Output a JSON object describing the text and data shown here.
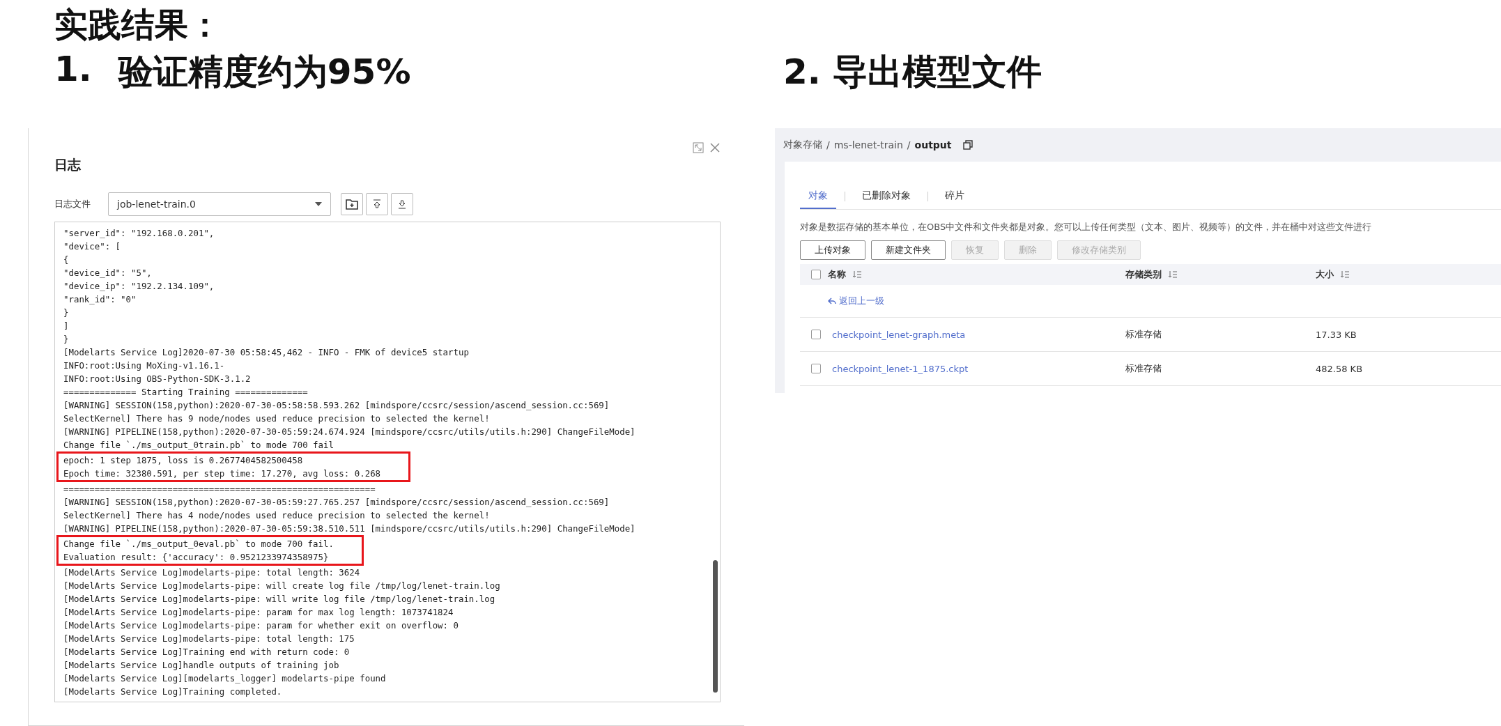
{
  "slide_title": "实践结果：",
  "left": {
    "heading_number": "1.",
    "heading": "验证精度约为95%",
    "log_dialog": {
      "title": "日志",
      "file_label": "日志文件",
      "file_value": "job-lenet-train.0",
      "blocks": [
        {
          "highlighted": false,
          "lines": [
            "\"server_id\": \"192.168.0.201\",",
            "\"device\": [",
            "{",
            "\"device_id\": \"5\",",
            "\"device_ip\": \"192.2.134.109\",",
            "\"rank_id\": \"0\"",
            "}",
            "]",
            "}",
            "[Modelarts Service Log]2020-07-30 05:58:45,462 - INFO - FMK of device5 startup",
            "INFO:root:Using MoXing-v1.16.1-",
            "INFO:root:Using OBS-Python-SDK-3.1.2",
            "============== Starting Training ==============",
            "[WARNING] SESSION(158,python):2020-07-30-05:58:58.593.262 [mindspore/ccsrc/session/ascend_session.cc:569]",
            "SelectKernel] There has 9 node/nodes used reduce precision to selected the kernel!",
            "[WARNING] PIPELINE(158,python):2020-07-30-05:59:24.674.924 [mindspore/ccsrc/utils/utils.h:290] ChangeFileMode]",
            "Change file `./ms_output_0train.pb` to mode 700 fail"
          ]
        },
        {
          "highlighted": true,
          "lines": [
            "epoch: 1 step 1875, loss is 0.2677404582500458",
            "Epoch time: 32380.591, per step time: 17.270, avg loss: 0.268"
          ]
        },
        {
          "highlighted": false,
          "lines": [
            "============================================================",
            "[WARNING] SESSION(158,python):2020-07-30-05:59:27.765.257 [mindspore/ccsrc/session/ascend_session.cc:569]",
            "SelectKernel] There has 4 node/nodes used reduce precision to selected the kernel!",
            "[WARNING] PIPELINE(158,python):2020-07-30-05:59:38.510.511 [mindspore/ccsrc/utils/utils.h:290] ChangeFileMode]"
          ]
        },
        {
          "highlighted": true,
          "lines": [
            "Change file `./ms_output_0eval.pb` to mode 700 fail.",
            "Evaluation result: {'accuracy': 0.9521233974358975}"
          ]
        },
        {
          "highlighted": false,
          "lines": [
            "[ModelArts Service Log]modelarts-pipe: total length: 3624",
            "[ModelArts Service Log]modelarts-pipe: will create log file /tmp/log/lenet-train.log",
            "[ModelArts Service Log]modelarts-pipe: will write log file /tmp/log/lenet-train.log",
            "[ModelArts Service Log]modelarts-pipe: param for max log length: 1073741824",
            "[ModelArts Service Log]modelarts-pipe: param for whether exit on overflow: 0",
            "[ModelArts Service Log]modelarts-pipe: total length: 175",
            "[Modelarts Service Log]Training end with return code: 0",
            "[Modelarts Service Log]handle outputs of training job",
            "[Modelarts Service Log][modelarts_logger] modelarts-pipe found",
            "[Modelarts Service Log]Training completed."
          ]
        }
      ]
    }
  },
  "right": {
    "heading": "2. 导出模型文件",
    "breadcrumb_separator": "/",
    "breadcrumb": [
      {
        "text": "对象存储",
        "current": false
      },
      {
        "text": "ms-lenet-train",
        "current": false
      },
      {
        "text": "output",
        "current": true
      }
    ],
    "tabs": [
      {
        "label": "对象",
        "selected": true
      },
      {
        "label": "已删除对象",
        "selected": false
      },
      {
        "label": "碎片",
        "selected": false
      }
    ],
    "description": "对象是数据存储的基本单位，在OBS中文件和文件夹都是对象。您可以上传任何类型（文本、图片、视频等）的文件，并在桶中对这些文件进行",
    "buttons": [
      {
        "label": "上传对象",
        "disabled": false
      },
      {
        "label": "新建文件夹",
        "disabled": false
      },
      {
        "label": "恢复",
        "disabled": true
      },
      {
        "label": "删除",
        "disabled": true
      },
      {
        "label": "修改存储类别",
        "disabled": true
      }
    ],
    "table": {
      "select_all_checked": false,
      "columns": [
        "名称",
        "存储类别",
        "大小"
      ],
      "back_link": "返回上一级",
      "rows": [
        {
          "checked": false,
          "name": "checkpoint_lenet-graph.meta",
          "storage_class": "标准存储",
          "size": "17.33 KB"
        },
        {
          "checked": false,
          "name": "checkpoint_lenet-1_1875.ckpt",
          "storage_class": "标准存储",
          "size": "482.58 KB"
        }
      ]
    }
  }
}
